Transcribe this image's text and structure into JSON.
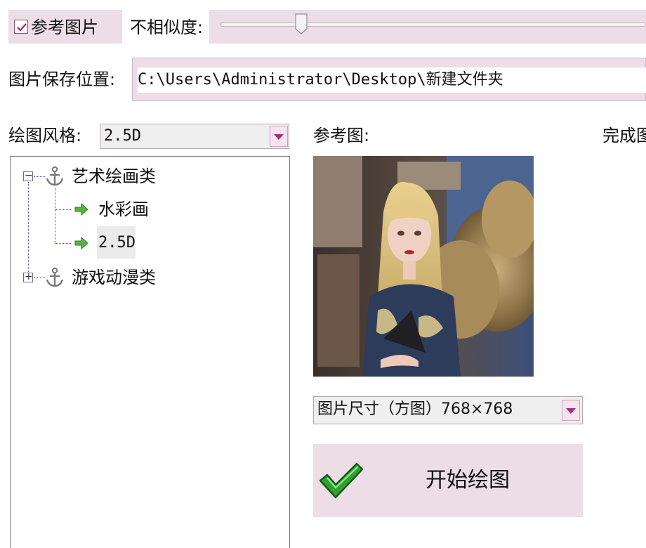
{
  "reference": {
    "checkbox_label": "参考图片",
    "checked": true,
    "similarity_label": "不相似度:",
    "similarity_value": 0.18
  },
  "save": {
    "label": "图片保存位置:",
    "path": "C:\\Users\\Administrator\\Desktop\\新建文件夹"
  },
  "style": {
    "label": "绘图风格:",
    "selected": "2.5D"
  },
  "tree": {
    "group1": {
      "label": "艺术绘画类",
      "expander": "⊟",
      "children": [
        "水彩画",
        "2.5D"
      ]
    },
    "group2": {
      "label": "游戏动漫类",
      "expander": "⊞"
    }
  },
  "preview": {
    "ref_label": "参考图:",
    "done_label": "完成图"
  },
  "size": {
    "selected": "图片尺寸（方图）768×768"
  },
  "start": {
    "label": "开始绘图"
  },
  "colors": {
    "accent": "#a3317c",
    "panel": "#ecdde6",
    "check_green": "#2fa12f"
  }
}
